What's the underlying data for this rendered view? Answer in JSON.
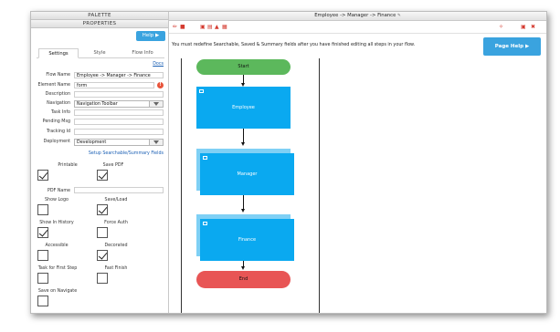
{
  "palette_bar": "PALETTE",
  "properties_bar": "PROPERTIES",
  "help_button": "Help ▶",
  "tabs": [
    "Settings",
    "Style",
    "Flow Info"
  ],
  "docs_link": "Docs",
  "fields": {
    "flow_name_label": "Flow Name",
    "flow_name_value": "Employee -> Manager -> Finance",
    "element_name_label": "Element Name",
    "element_name_value": "form",
    "description_label": "Description",
    "description_value": "",
    "navigation_label": "Navigation",
    "navigation_value": "Navigation Toolbar",
    "task_info_label": "Task Info",
    "pending_msg_label": "Pending Msg",
    "tracking_id_label": "Tracking Id",
    "deployment_label": "Deployment",
    "deployment_value": "Development",
    "warn_icon": "!"
  },
  "setup_link": "Setup Searchable/Summary Fields",
  "checkboxes": {
    "printable": "Printable",
    "save_pdf": "Save PDF",
    "pdf_name": "PDF Name",
    "show_logo": "Show Logo",
    "save_load": "Save/Load",
    "show_in_history": "Show In History",
    "force_auth": "Force Auth",
    "accessible": "Accessible",
    "decorated": "Decorated",
    "task_for_first_step": "Task for First Step",
    "fast_finish": "Fast Finish",
    "save_on_navigate": "Save on Navigate"
  },
  "flow_title": "Employee -> Manager -> Finance",
  "flow_title_icon": "edit-icon",
  "message": "You must redefine Searchable, Saved & Summary fields after you have finished editing all steps in your flow.",
  "page_help": "Page Help ▶",
  "flow": {
    "start": "Start",
    "employee": "Employee",
    "manager": "Manager",
    "finance": "Finance",
    "end": "End"
  },
  "colors": {
    "accent": "#3aa3df",
    "start": "#5cb85c",
    "end": "#e85555",
    "node": "#0aa9f0",
    "toolbar_icon": "#d43a2f"
  }
}
